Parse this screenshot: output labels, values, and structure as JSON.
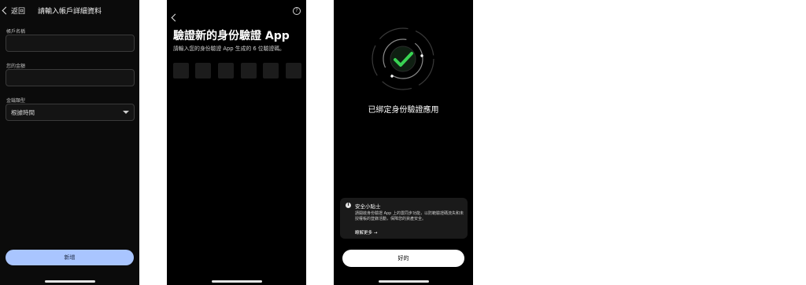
{
  "screen1": {
    "back_label": "返回",
    "title": "請輸入帳戶詳細資料",
    "account_name_label": "帳戶名稱",
    "account_name_value": "",
    "amount_label": "您的金額",
    "amount_value": "",
    "type_label": "金鑰類型",
    "type_value": "根據時間",
    "submit_label": "新增"
  },
  "screen2": {
    "title": "驗證新的身份驗證 App",
    "subtitle": "請輸入您的身份驗證 App 生成的 6 位驗證碼。",
    "help_icon_text": "?"
  },
  "screen3": {
    "status_title": "已綁定身份驗證應用",
    "tip_title": "安全小貼士",
    "tip_body": "請開啟身份驗證 App 上的雲同步功能，以防範驗證碼流失和未授權帳的登錄活動，保障您的資產安全。",
    "learn_more": "瞭解更多 →",
    "ok_label": "好的",
    "accent_color": "#39d353"
  }
}
